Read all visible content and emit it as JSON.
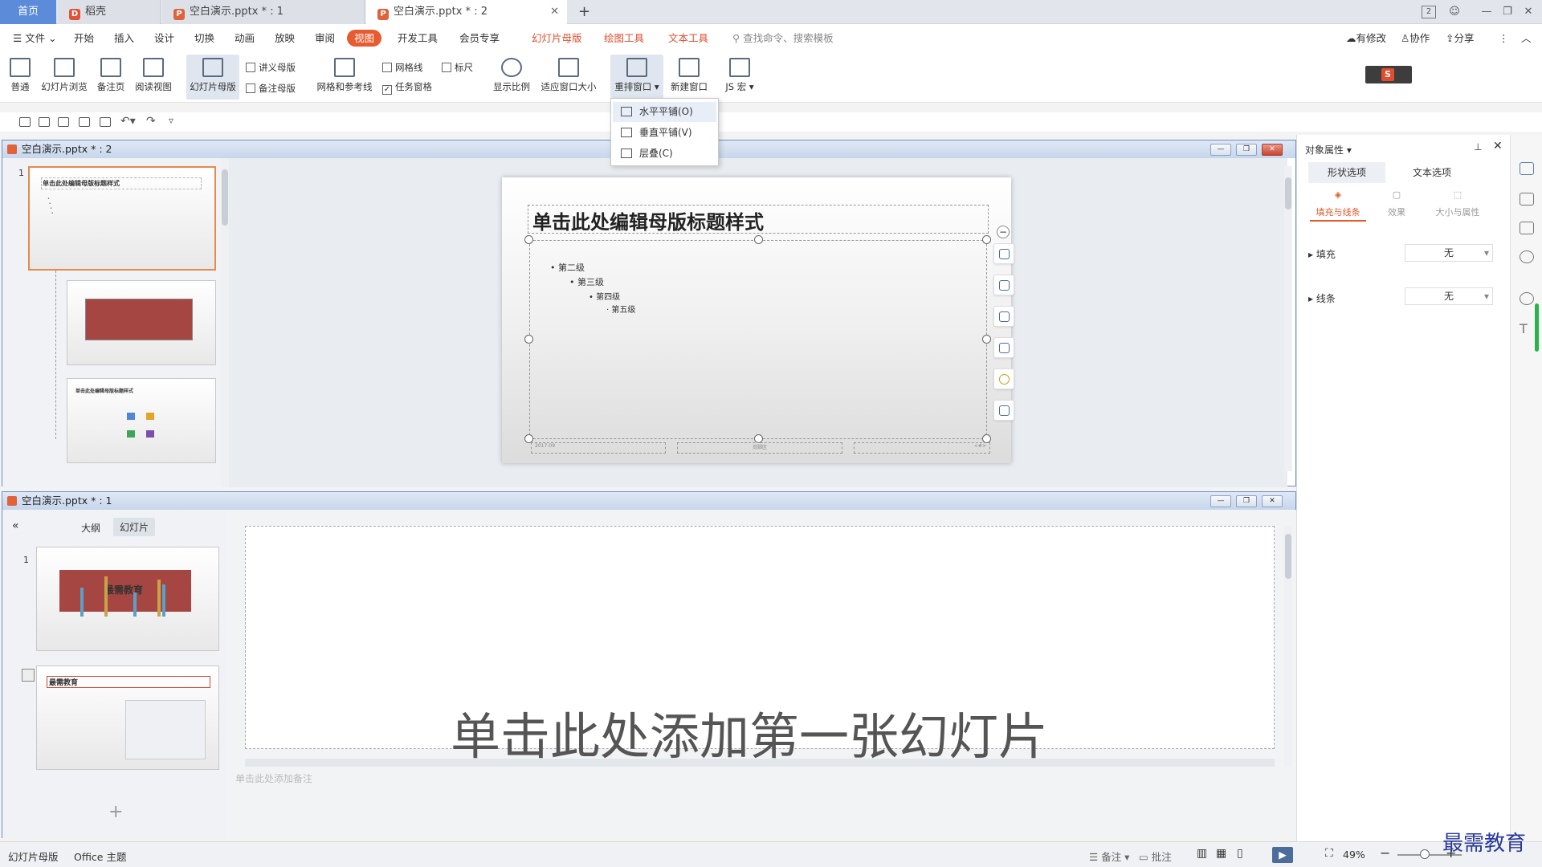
{
  "tabs": {
    "home": "首页",
    "docer": "稻壳",
    "doc1": "空白演示.pptx * : 1",
    "doc2": "空白演示.pptx * : 2",
    "new_tab": "+"
  },
  "title_badge": "2",
  "menu": {
    "file": "文件",
    "items": [
      "开始",
      "插入",
      "设计",
      "切换",
      "动画",
      "放映",
      "审阅",
      "视图",
      "开发工具",
      "会员专享"
    ],
    "contextual": [
      "幻灯片母版",
      "绘图工具",
      "文本工具"
    ],
    "search_placeholder": "查找命令、搜索模板",
    "right": [
      "有修改",
      "协作",
      "分享"
    ]
  },
  "ribbon": {
    "normal": "普通",
    "slide_sorter": "幻灯片浏览",
    "notes_page": "备注页",
    "reading_view": "阅读视图",
    "slide_master": "幻灯片母版",
    "handout_master": "讲义母版",
    "notes_master": "备注母版",
    "grid_guides": "网格和参考线",
    "gridlines": "网格线",
    "ruler": "标尺",
    "task_pane": "任务窗格",
    "zoom": "显示比例",
    "fit_window": "适应窗口大小",
    "arrange": "重排窗口",
    "new_window": "新建窗口",
    "js_macro": "JS 宏"
  },
  "arrange_menu": [
    "水平平铺(O)",
    "垂直平铺(V)",
    "层叠(C)"
  ],
  "window_top": {
    "title": "空白演示.pptx * : 2",
    "slide_num": "1",
    "master_title_small": "单击此处编辑母版标题样式",
    "slide_title": "单击此处编辑母版标题样式",
    "levels": [
      "第二级",
      "第三级",
      "第四级",
      "第五级"
    ],
    "footer_date": "2017-09",
    "footer_mid": "页脚区",
    "footer_num": "<#>"
  },
  "window_bottom": {
    "title": "空白演示.pptx * : 1",
    "tab_outline": "大纲",
    "tab_slides": "幻灯片",
    "slide_num": "1",
    "thumb1_text": "最需教育",
    "thumb2_title": "最需教育",
    "add_slide_hint": "单击此处添加第一张幻灯片",
    "notes_hint": "单击此处添加备注"
  },
  "props": {
    "title": "对象属性",
    "tab_shape": "形状选项",
    "tab_text": "文本选项",
    "sub_fill": "填充与线条",
    "sub_effect": "效果",
    "sub_size": "大小与属性",
    "fill": "填充",
    "line": "线条",
    "none": "无"
  },
  "status": {
    "mode": "幻灯片母版",
    "theme": "Office 主题",
    "notes": "备注",
    "comments": "批注",
    "zoom": "49%"
  },
  "watermark": "最需教育",
  "colors": {
    "accent": "#e85a2f",
    "home_tab": "#5b8bd9",
    "thumb_red": "#a64642"
  }
}
